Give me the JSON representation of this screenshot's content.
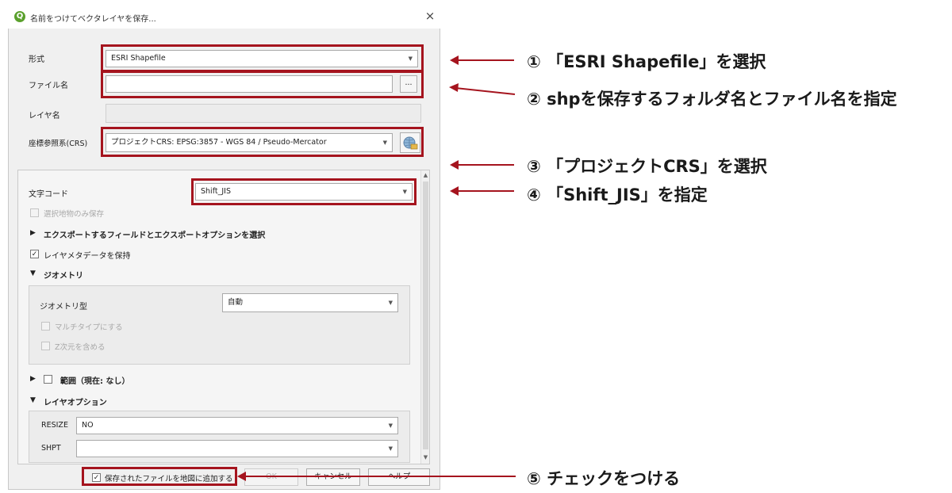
{
  "dialog": {
    "title": "名前をつけてベクタレイヤを保存...",
    "app_icon": "qgis-icon",
    "close_label": "×"
  },
  "form": {
    "format_label": "形式",
    "format_value": "ESRI Shapefile",
    "filename_label": "ファイル名",
    "filename_value": "",
    "browse_label": "...",
    "layername_label": "レイヤ名",
    "layername_value": "",
    "crs_label": "座標参照系(CRS)",
    "crs_value": "プロジェクトCRS: EPSG:3857 - WGS 84 / Pseudo-Mercator",
    "crs_button_icon": "globe-icon"
  },
  "options": {
    "encoding_label": "文字コード",
    "encoding_value": "Shift_JIS",
    "selected_only_label": "選択地物のみ保存",
    "export_fields_label": "エクスポートするフィールドとエクスポートオプションを選択",
    "keep_metadata_label": "レイヤメタデータを保持",
    "keep_metadata_checked": true,
    "geometry_section": "ジオメトリ",
    "geometry_type_label": "ジオメトリ型",
    "geometry_type_value": "自動",
    "multitype_label": "マルチタイプにする",
    "z_label": "Z次元を含める",
    "extent_label": "範囲（現在: なし）",
    "layer_options_section": "レイヤオプション",
    "resize_label": "RESIZE",
    "resize_value": "NO",
    "shpt_label": "SHPT",
    "shpt_value": ""
  },
  "footer": {
    "add_to_map_label": "保存されたファイルを地図に追加する",
    "add_to_map_checked": true,
    "ok_label": "OK",
    "cancel_label": "キャンセル",
    "help_label": "ヘルプ"
  },
  "annotations": [
    "① 「ESRI Shapefile」を選択",
    "② shpを保存するフォルダ名とファイル名を指定",
    "③ 「プロジェクトCRS」を選択",
    "④ 「Shift_JIS」を指定",
    "⑤ チェックをつける"
  ],
  "colors": {
    "highlight": "#a5141e",
    "qgis_green": "#5aa02c"
  }
}
